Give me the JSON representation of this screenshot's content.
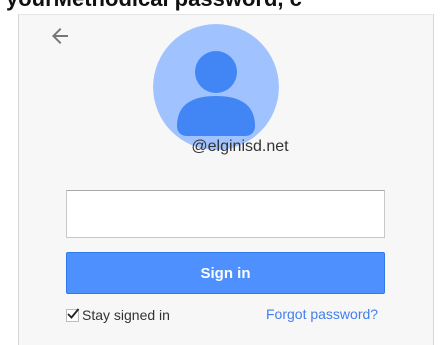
{
  "background_text": "yourMethodical password, c",
  "account": {
    "email": "@elginisd.net"
  },
  "form": {
    "password_value": "",
    "password_placeholder": "",
    "signin_label": "Sign in",
    "stay_signed_in_label": "Stay signed in",
    "stay_signed_in_checked": true,
    "forgot_password_label": "Forgot password?"
  },
  "icons": {
    "back": "back-arrow-icon",
    "avatar": "default-avatar-icon",
    "check": "checkmark-icon"
  },
  "colors": {
    "primary_button": "#4d90fe",
    "link": "#427fed",
    "avatar_bg": "#a0c3ff",
    "avatar_fg": "#4285f4"
  }
}
